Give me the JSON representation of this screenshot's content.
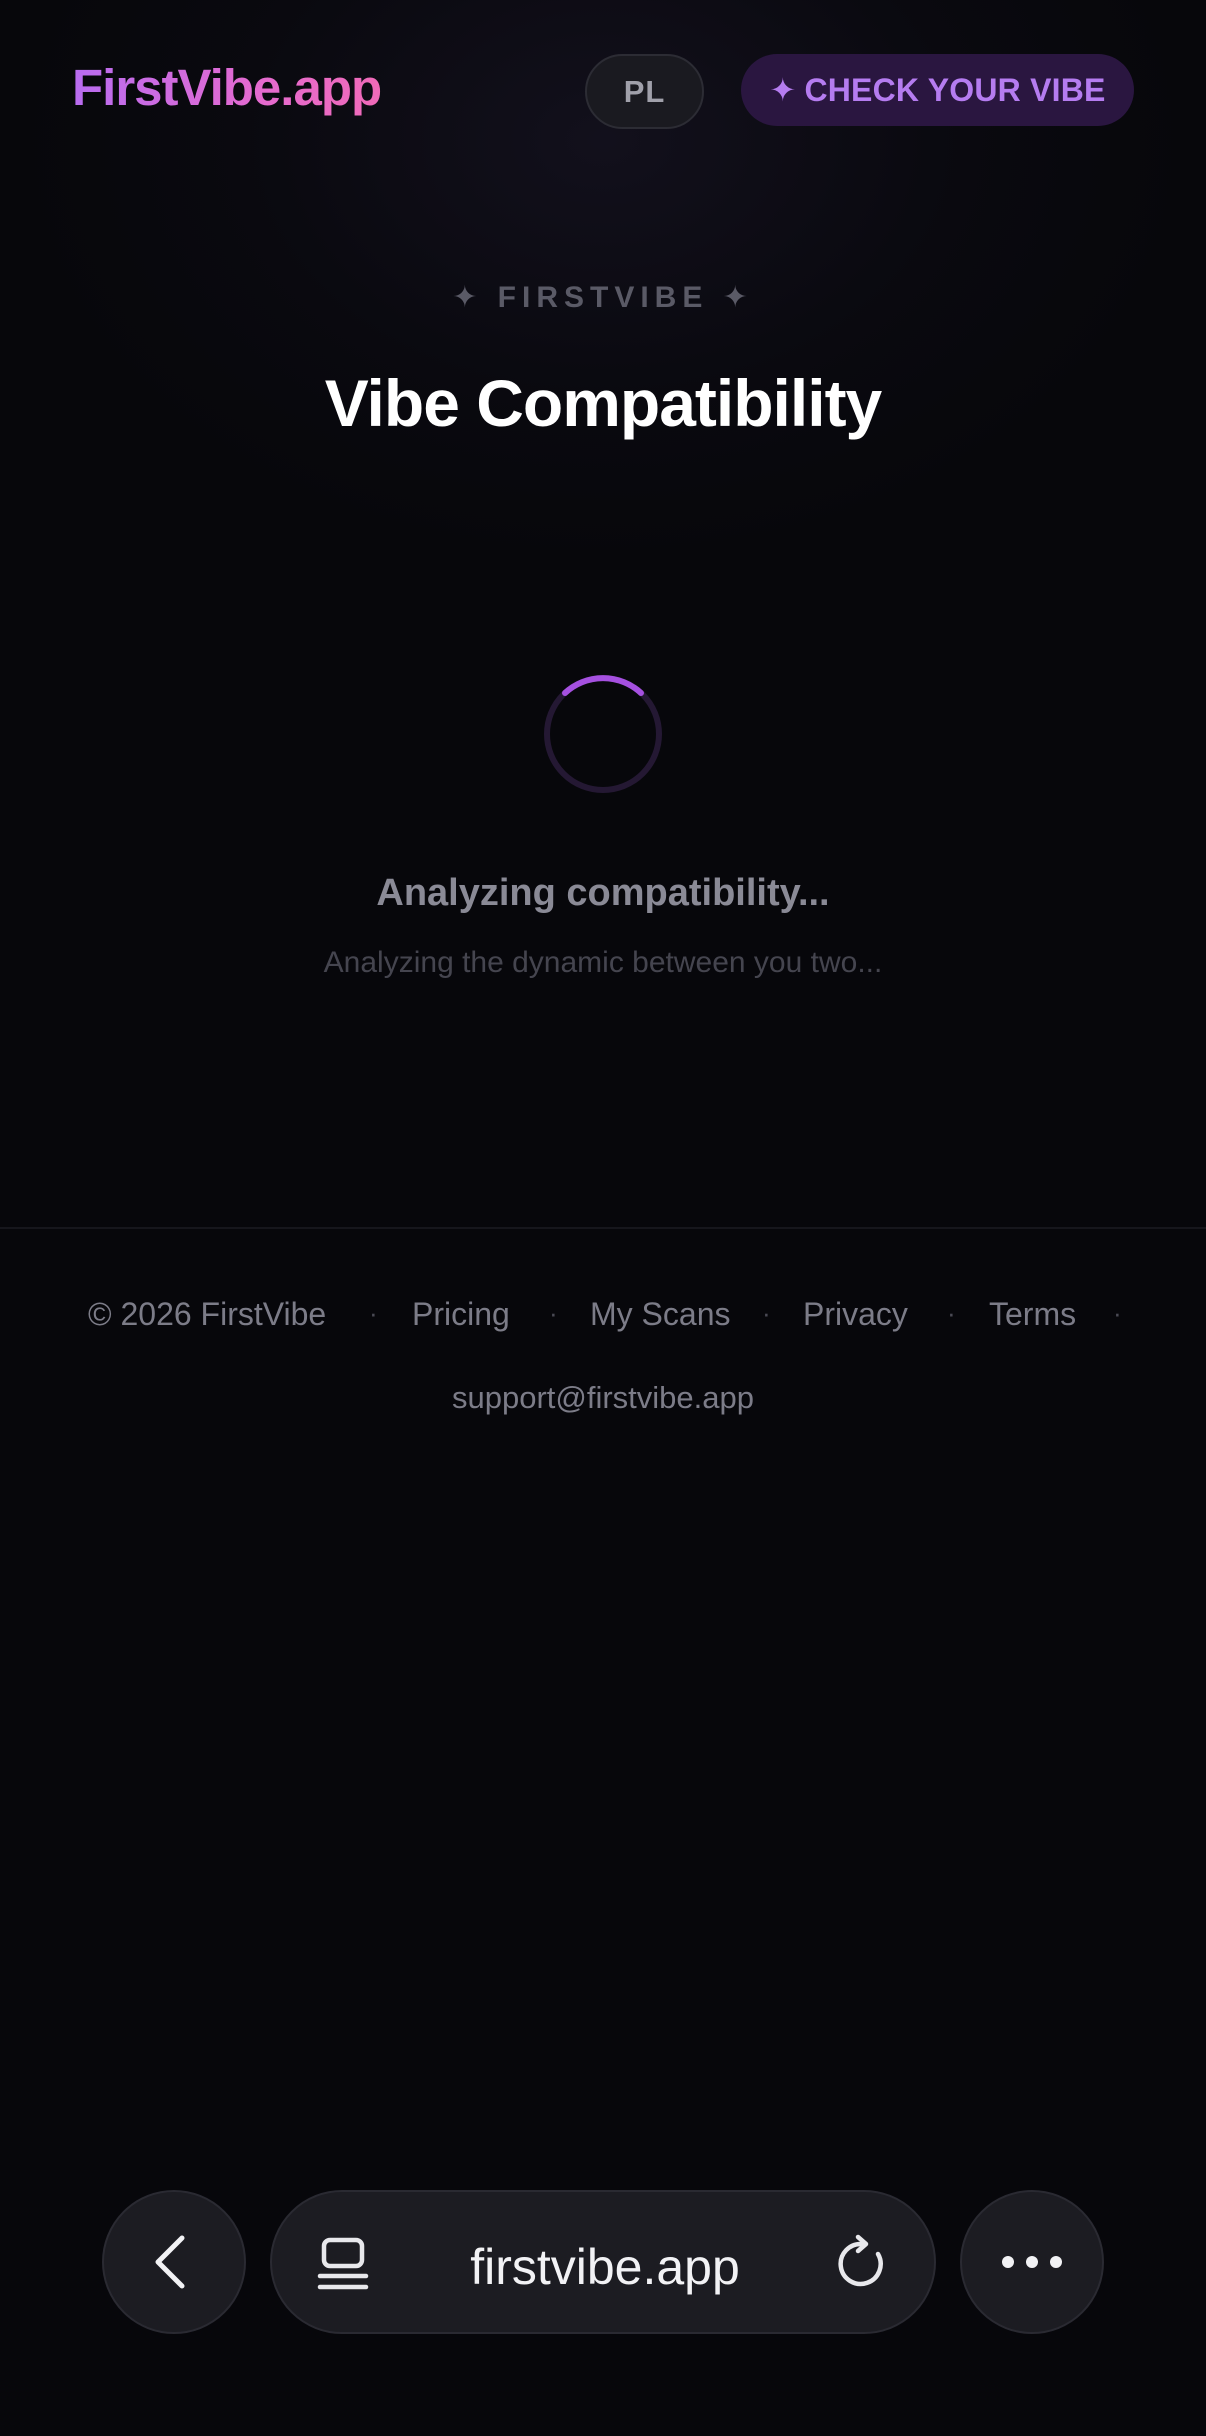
{
  "header": {
    "logo": "FirstVibe.app",
    "lang_label": "PL",
    "cta_icon": "sparkle-icon",
    "cta_label": "CHECK YOUR VIBE"
  },
  "hero": {
    "eyebrow": "✦ FIRSTVIBE ✦",
    "title": "Vibe Compatibility"
  },
  "loading": {
    "title": "Analyzing compatibility...",
    "subtitle": "Analyzing the dynamic between you two..."
  },
  "footer": {
    "copyright": "© 2026 FirstVibe",
    "links": [
      "Pricing",
      "My Scans",
      "Privacy",
      "Terms"
    ],
    "separator": "·",
    "support_email": "support@firstvibe.app"
  },
  "browser": {
    "url": "firstvibe.app",
    "back_icon": "chevron-left-icon",
    "tabs_icon": "tabs-icon",
    "reload_icon": "reload-icon",
    "more_icon": "ellipsis-icon"
  },
  "colors": {
    "accent": "#b57cf0",
    "logo_gradient_start": "#b86cf0",
    "logo_gradient_end": "#f06ab8",
    "background": "#07070b"
  }
}
